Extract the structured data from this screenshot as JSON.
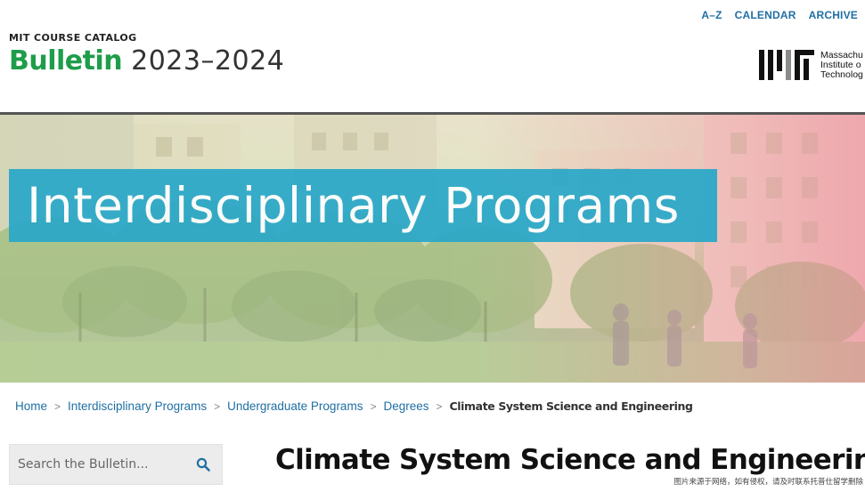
{
  "top_nav": {
    "items": [
      {
        "label": "A–Z"
      },
      {
        "label": "CALENDAR"
      },
      {
        "label": "ARCHIVE"
      }
    ]
  },
  "header": {
    "kicker": "MIT COURSE CATALOG",
    "title": "Bulletin",
    "years": "2023–2024"
  },
  "logo": {
    "lines": [
      "Massachu",
      "Institute o",
      "Technolog"
    ]
  },
  "hero": {
    "title": "Interdisciplinary Programs"
  },
  "breadcrumb": {
    "items": [
      {
        "label": "Home"
      },
      {
        "label": "Interdisciplinary Programs"
      },
      {
        "label": "Undergraduate Programs"
      },
      {
        "label": "Degrees"
      }
    ],
    "current": "Climate System Science and Engineering",
    "separator": ">"
  },
  "search": {
    "placeholder": "Search the Bulletin...",
    "icon": "search-icon"
  },
  "page": {
    "title": "Climate System Science and Engineering"
  },
  "watermark": "图片来源于网络，如有侵权，请及时联系托普仕留学删除",
  "colors": {
    "link": "#1f6fa3",
    "brand_green": "#1e9d4a",
    "banner": "#2aa8c9"
  }
}
